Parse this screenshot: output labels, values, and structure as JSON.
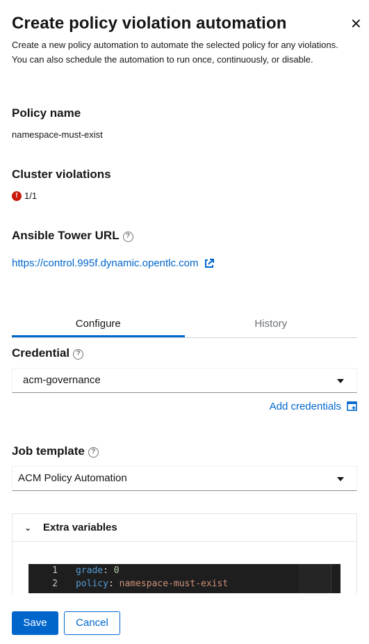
{
  "header": {
    "title": "Create policy violation automation",
    "description": "Create a new policy automation to automate the selected policy for any violations. You can also schedule the automation to run once, continuously, or disable."
  },
  "policy": {
    "label": "Policy name",
    "value": "namespace-must-exist"
  },
  "violations": {
    "label": "Cluster violations",
    "value": "1/1"
  },
  "tower": {
    "label": "Ansible Tower URL",
    "url": "https://control.995f.dynamic.opentlc.com"
  },
  "tabs": [
    {
      "label": "Configure"
    },
    {
      "label": "History"
    }
  ],
  "credential": {
    "label": "Credential",
    "value": "acm-governance",
    "add_label": "Add credentials"
  },
  "job_template": {
    "label": "Job template",
    "value": "ACM Policy Automation"
  },
  "extra_vars": {
    "label": "Extra variables",
    "lines": [
      {
        "num": "1",
        "key": "grade",
        "value": "0"
      },
      {
        "num": "2",
        "key": "policy",
        "value": "namespace-must-exist"
      }
    ]
  },
  "footer": {
    "save_label": "Save",
    "cancel_label": "Cancel"
  },
  "colors": {
    "accent": "#0066cc",
    "danger": "#c9190b"
  }
}
